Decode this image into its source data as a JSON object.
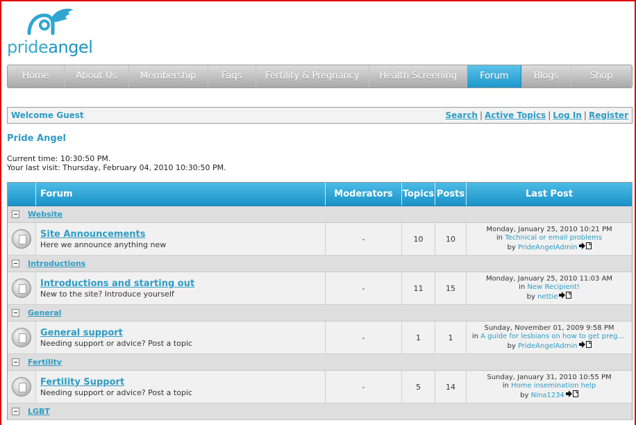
{
  "logo": {
    "text_pre": "pride",
    "text_post": "angel"
  },
  "nav": {
    "items": [
      {
        "label": "Home",
        "width": 82
      },
      {
        "label": "About Us",
        "width": 93
      },
      {
        "label": "Membership",
        "width": 114
      },
      {
        "label": "Faqs",
        "width": 69
      },
      {
        "label": "Fertility & Pregnancy",
        "width": 164
      },
      {
        "label": "Health Screening",
        "width": 141
      },
      {
        "label": "Forum",
        "width": 78,
        "active": true
      },
      {
        "label": "Blogs",
        "width": 72
      },
      {
        "label": "Shop",
        "width": 87
      }
    ]
  },
  "welcome": {
    "label": "Welcome Guest",
    "links": [
      "Search",
      "Active Topics",
      "Log In",
      "Register"
    ]
  },
  "site_title": "Pride Angel",
  "times": {
    "current": "Current time: 10:30:50 PM.",
    "last_visit": "Your last visit: Thursday, February 04, 2010 10:30:50 PM."
  },
  "table": {
    "headers": {
      "forum": "Forum",
      "moderators": "Moderators",
      "topics": "Topics",
      "posts": "Posts",
      "last_post": "Last Post"
    },
    "categories": [
      {
        "name": "Website",
        "forums": [
          {
            "name": "Site Announcements",
            "desc": "Here we announce anything new",
            "moderators": "-",
            "topics": "10",
            "posts": "10",
            "last_date": "Monday, January 25, 2010 10:21 PM",
            "in": "in",
            "last_topic": "Technical or email problems",
            "by": "by",
            "last_user": "PrideAngelAdmin"
          }
        ]
      },
      {
        "name": "Introductions",
        "forums": [
          {
            "name": "Introductions and starting out",
            "desc": "New to the site? Introduce yourself",
            "moderators": "-",
            "topics": "11",
            "posts": "15",
            "last_date": "Monday, January 25, 2010 11:03 AM",
            "in": "in",
            "last_topic": "New Recipient!",
            "by": "by",
            "last_user": "nettie"
          }
        ]
      },
      {
        "name": "General",
        "forums": [
          {
            "name": "General support",
            "desc": "Needing support or advice? Post a topic",
            "moderators": "-",
            "topics": "1",
            "posts": "1",
            "last_date": "Sunday, November 01, 2009 9:58 PM",
            "in": "in",
            "last_topic": "A guide for lesbians on how to get pregnant -...",
            "by": "by",
            "last_user": "PrideAngelAdmin"
          }
        ]
      },
      {
        "name": "Fertility",
        "forums": [
          {
            "name": "Fertility Support",
            "desc": "Needing support or advice? Post a topic",
            "moderators": "-",
            "topics": "5",
            "posts": "14",
            "last_date": "Sunday, January 31, 2010 10:55 PM",
            "in": "in",
            "last_topic": "Home insemination help",
            "by": "by",
            "last_user": "Nina1234"
          }
        ]
      },
      {
        "name": "LGBT",
        "forums": []
      }
    ]
  },
  "colors": {
    "accent": "#2f9cc4",
    "nav_active": "#1b97cc",
    "frame": "#e00000"
  }
}
